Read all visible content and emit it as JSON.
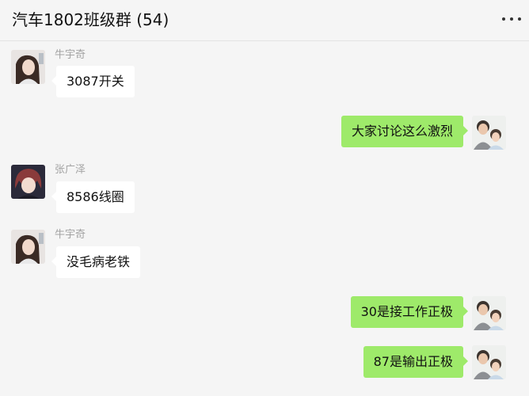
{
  "chat": {
    "title": "汽车1802班级群 (54)",
    "more_icon": "more-dots-icon"
  },
  "messages": [
    {
      "direction": "incoming",
      "sender": "牛宇奇",
      "text": "3087开关",
      "avatar": "avatar-girl-icon"
    },
    {
      "direction": "outgoing",
      "text": "大家讨论这么激烈",
      "avatar": "avatar-family-icon"
    },
    {
      "direction": "incoming",
      "sender": "张广泽",
      "text": "8586线圈",
      "avatar": "avatar-anime-icon"
    },
    {
      "direction": "incoming",
      "sender": "牛宇奇",
      "text": "没毛病老铁",
      "avatar": "avatar-girl-icon"
    },
    {
      "direction": "outgoing",
      "text": "30是接工作正极",
      "avatar": "avatar-family-icon"
    },
    {
      "direction": "outgoing",
      "text": "87是输出正极",
      "avatar": "avatar-family-icon"
    }
  ],
  "colors": {
    "background": "#f5f5f5",
    "incoming_bubble": "#ffffff",
    "outgoing_bubble": "#9eea6a"
  }
}
